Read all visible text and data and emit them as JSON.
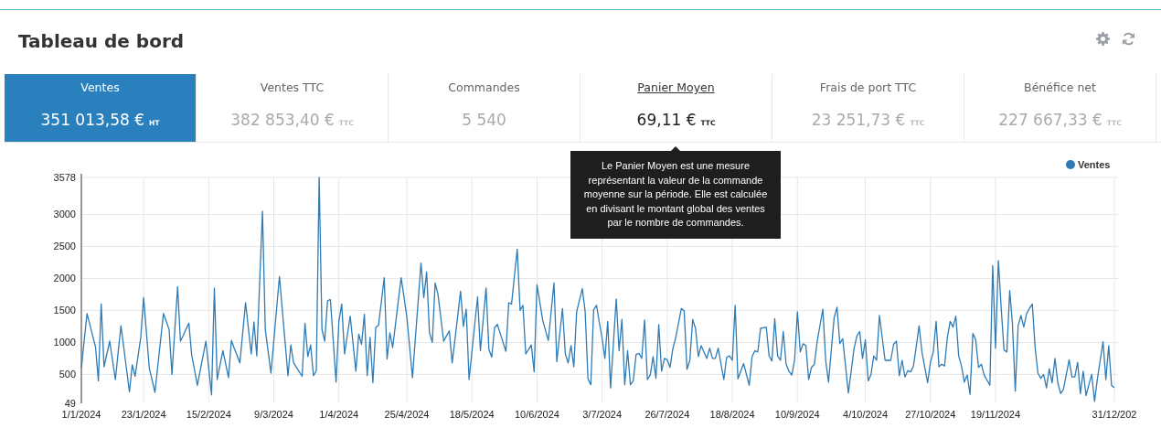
{
  "header": {
    "title": "Tableau de bord"
  },
  "kpis": [
    {
      "label": "Ventes",
      "value": "351 013,58 €",
      "unit": "HT",
      "selected": true,
      "hovered": false
    },
    {
      "label": "Ventes TTC",
      "value": "382 853,40 €",
      "unit": "TTC",
      "selected": false,
      "hovered": false
    },
    {
      "label": "Commandes",
      "value": "5 540",
      "selected": false,
      "hovered": false
    },
    {
      "label": "Panier Moyen",
      "value": "69,11 €",
      "unit": "TTC",
      "selected": false,
      "hovered": true
    },
    {
      "label": "Frais de port TTC",
      "value": "23 251,73 €",
      "unit": "TTC",
      "selected": false,
      "hovered": false
    },
    {
      "label": "Bénéfice net",
      "value": "227 667,33 €",
      "unit": "TTC",
      "selected": false,
      "hovered": false
    }
  ],
  "tooltip": {
    "text": "Le Panier Moyen est une mesure représentant la valeur de la commande moyenne sur la période. Elle est calculée en divisant le montant global des ventes par le nombre de commandes."
  },
  "chart": {
    "chart_data": {
      "type": "line",
      "categories": [
        "1/1/2024",
        null,
        null,
        null,
        null,
        null,
        null,
        null,
        null,
        null,
        null,
        null,
        null,
        null,
        null,
        null,
        null,
        null,
        null,
        null,
        null,
        null,
        "23/1/2024",
        null,
        null,
        null,
        null,
        null,
        null,
        null,
        null,
        null,
        null,
        null,
        null,
        null,
        null,
        null,
        null,
        null,
        null,
        null,
        null,
        null,
        null,
        "15/2/2024",
        null,
        null,
        null,
        null,
        null,
        null,
        null,
        null,
        null,
        null,
        null,
        null,
        null,
        null,
        null,
        null,
        null,
        null,
        null,
        null,
        null,
        null,
        "9/3/2024",
        null,
        null,
        null,
        null,
        null,
        null,
        null,
        null,
        null,
        null,
        null,
        null,
        null,
        null,
        null,
        null,
        null,
        null,
        null,
        null,
        null,
        null,
        "1/4/2024",
        null,
        null,
        null,
        null,
        null,
        null,
        null,
        null,
        null,
        null,
        null,
        null,
        null,
        null,
        null,
        null,
        null,
        null,
        null,
        null,
        null,
        null,
        null,
        "25/4/2024",
        null,
        null,
        null,
        null,
        null,
        null,
        null,
        null,
        null,
        null,
        null,
        null,
        null,
        null,
        null,
        null,
        null,
        null,
        null,
        null,
        null,
        null,
        "18/5/2024",
        null,
        null,
        null,
        null,
        null,
        null,
        null,
        null,
        null,
        null,
        null,
        null,
        null,
        null,
        null,
        null,
        null,
        null,
        null,
        null,
        null,
        null,
        "10/6/2024",
        null,
        null,
        null,
        null,
        null,
        null,
        null,
        null,
        null,
        null,
        null,
        null,
        null,
        null,
        null,
        null,
        null,
        null,
        null,
        null,
        null,
        null,
        "3/7/2024",
        null,
        null,
        null,
        null,
        null,
        null,
        null,
        null,
        null,
        null,
        null,
        null,
        null,
        null,
        null,
        null,
        null,
        null,
        null,
        null,
        null,
        null,
        "26/7/2024",
        null,
        null,
        null,
        null,
        null,
        null,
        null,
        null,
        null,
        null,
        null,
        null,
        null,
        null,
        null,
        null,
        null,
        null,
        null,
        null,
        null,
        null,
        "18/8/2024",
        null,
        null,
        null,
        null,
        null,
        null,
        null,
        null,
        null,
        null,
        null,
        null,
        null,
        null,
        null,
        null,
        null,
        null,
        null,
        null,
        null,
        null,
        "10/9/2024",
        null,
        null,
        null,
        null,
        null,
        null,
        null,
        null,
        null,
        null,
        null,
        null,
        null,
        null,
        null,
        null,
        null,
        null,
        null,
        null,
        null,
        null,
        null,
        "4/10/2024",
        null,
        null,
        null,
        null,
        null,
        null,
        null,
        null,
        null,
        null,
        null,
        null,
        null,
        null,
        null,
        null,
        null,
        null,
        null,
        null,
        null,
        null,
        "27/10/2024",
        null,
        null,
        null,
        null,
        null,
        null,
        null,
        null,
        null,
        null,
        null,
        null,
        null,
        null,
        null,
        null,
        null,
        null,
        null,
        null,
        null,
        null,
        "19/11/2024",
        null,
        null,
        null,
        null,
        null,
        null,
        null,
        null,
        null,
        null,
        null,
        null,
        null,
        null,
        null,
        null,
        null,
        null,
        null,
        null,
        null,
        null,
        null,
        null,
        null,
        null,
        null,
        null,
        null,
        null,
        null,
        null,
        null,
        null,
        null,
        null,
        null,
        null,
        null,
        null,
        null,
        "31/12/202"
      ],
      "series": [
        {
          "name": "Ventes",
          "color": "#2e7bb5",
          "values": [
            600,
            1030,
            1450,
            1280,
            1100,
            930,
            400,
            1600,
            620,
            820,
            1020,
            720,
            420,
            840,
            1260,
            920,
            570,
            230,
            650,
            470,
            780,
            1080,
            1700,
            1150,
            600,
            410,
            220,
            630,
            1040,
            1450,
            1330,
            1200,
            500,
            1190,
            1870,
            1020,
            1110,
            1210,
            1300,
            800,
            570,
            330,
            560,
            790,
            1020,
            600,
            180,
            1850,
            420,
            650,
            870,
            660,
            450,
            1030,
            910,
            800,
            680,
            1150,
            1620,
            1220,
            820,
            1320,
            790,
            1920,
            3050,
            1200,
            860,
            520,
            1020,
            1530,
            2030,
            1510,
            1000,
            480,
            960,
            680,
            610,
            540,
            470,
            1300,
            780,
            960,
            480,
            560,
            3578,
            1200,
            1020,
            1650,
            1670,
            1030,
            380,
            1330,
            1600,
            820,
            1120,
            1410,
            980,
            550,
            1130,
            970,
            1440,
            480,
            1080,
            370,
            1230,
            1270,
            1640,
            2010,
            740,
            1150,
            920,
            1280,
            1650,
            2010,
            1710,
            1400,
            930,
            450,
            1050,
            1640,
            2240,
            1700,
            2100,
            1150,
            1000,
            1930,
            1750,
            1390,
            1020,
            1100,
            1180,
            680,
            1050,
            1430,
            1800,
            1250,
            1520,
            420,
            850,
            1280,
            1710,
            870,
            1360,
            1850,
            890,
            770,
            1230,
            1280,
            1140,
            1000,
            860,
            1620,
            1600,
            2030,
            2460,
            1500,
            1580,
            820,
            890,
            960,
            540,
            1900,
            1630,
            1350,
            1190,
            1030,
            1480,
            1930,
            700,
            1120,
            1530,
            820,
            680,
            950,
            620,
            1480,
            1660,
            1840,
            1480,
            430,
            340,
            1510,
            1580,
            1320,
            1070,
            750,
            1330,
            290,
            990,
            1680,
            870,
            1360,
            340,
            870,
            340,
            400,
            810,
            830,
            750,
            1350,
            420,
            490,
            780,
            440,
            1280,
            550,
            750,
            730,
            610,
            900,
            1070,
            1300,
            1530,
            1490,
            580,
            720,
            1360,
            1220,
            780,
            950,
            850,
            750,
            910,
            750,
            750,
            910,
            660,
            420,
            770,
            790,
            720,
            1580,
            430,
            550,
            670,
            500,
            330,
            780,
            870,
            850,
            1220,
            1230,
            1240,
            790,
            710,
            1370,
            790,
            720,
            1170,
            660,
            550,
            490,
            720,
            1480,
            850,
            980,
            950,
            420,
            610,
            660,
            1010,
            1270,
            1520,
            720,
            380,
            890,
            1390,
            1550,
            980,
            1060,
            640,
            210,
            550,
            900,
            1100,
            1170,
            750,
            1040,
            400,
            500,
            790,
            720,
            1420,
            1070,
            720,
            720,
            720,
            970,
            1020,
            480,
            720,
            460,
            560,
            540,
            630,
            940,
            1260,
            850,
            610,
            370,
            690,
            850,
            1330,
            620,
            660,
            630,
            1080,
            1330,
            1240,
            1410,
            790,
            630,
            380,
            490,
            190,
            1140,
            1040,
            610,
            660,
            490,
            410,
            330,
            2200,
            910,
            2280,
            1530,
            880,
            850,
            1810,
            1290,
            240,
            1260,
            1420,
            1240,
            1450,
            1530,
            1600,
            920,
            520,
            440,
            500,
            290,
            590,
            370,
            750,
            370,
            200,
            270,
            500,
            730,
            460,
            460,
            690,
            200,
            550,
            170,
            340,
            500,
            80,
            430,
            720,
            1010,
            420,
            950,
            330,
            290
          ]
        }
      ],
      "grid": true,
      "ylim": [
        49,
        3578
      ],
      "yticks": [
        49,
        500,
        1000,
        1500,
        2000,
        2500,
        3000,
        3578
      ]
    }
  }
}
